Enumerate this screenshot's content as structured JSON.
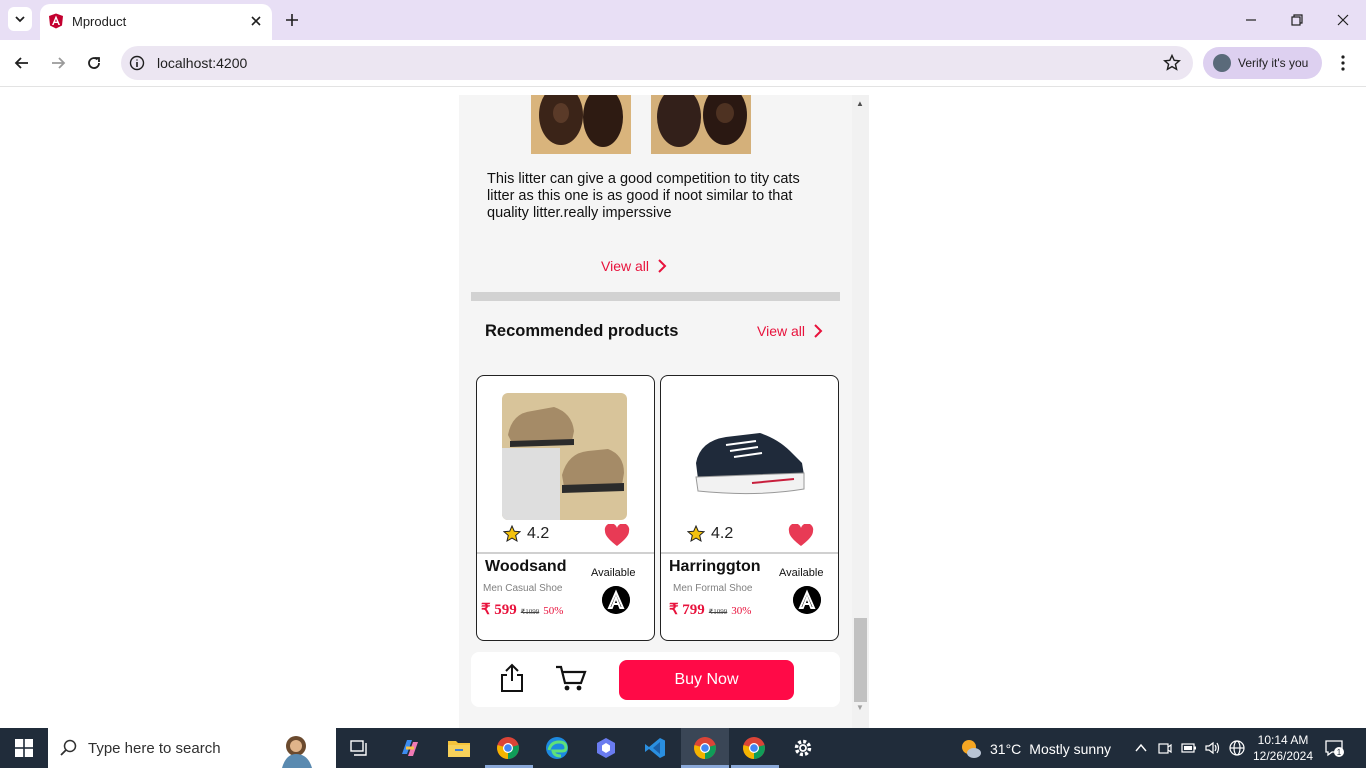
{
  "browser": {
    "tab_title": "Mproduct",
    "url": "localhost:4200",
    "profile_label": "Verify it's you"
  },
  "review": {
    "text": "This litter can give a good competition to tity cats litter as this one is as good if noot similar to that quality litter.really imperssive",
    "view_all": "View all"
  },
  "recommended": {
    "title": "Recommended products",
    "view_all": "View all",
    "products": [
      {
        "rating": "4.2",
        "name": "Woodsand",
        "subtitle": "Men Casual Shoe",
        "availability": "Available",
        "price": "₹ 599",
        "old_price": "₹1099",
        "discount": "50%"
      },
      {
        "rating": "4.2",
        "name": "Harringgton",
        "subtitle": "Men Formal Shoe",
        "availability": "Available",
        "price": "₹ 799",
        "old_price": "₹1099",
        "discount": "30%"
      }
    ]
  },
  "actions": {
    "buy_now": "Buy Now"
  },
  "taskbar": {
    "search_placeholder": "Type here to search",
    "weather_temp": "31°C",
    "weather_desc": "Mostly sunny",
    "time": "10:14 AM",
    "date": "12/26/2024",
    "notification_count": "1"
  },
  "colors": {
    "accent": "#e8123c",
    "buy_button": "#ff0a47",
    "tab_bar": "#e8dff5"
  }
}
